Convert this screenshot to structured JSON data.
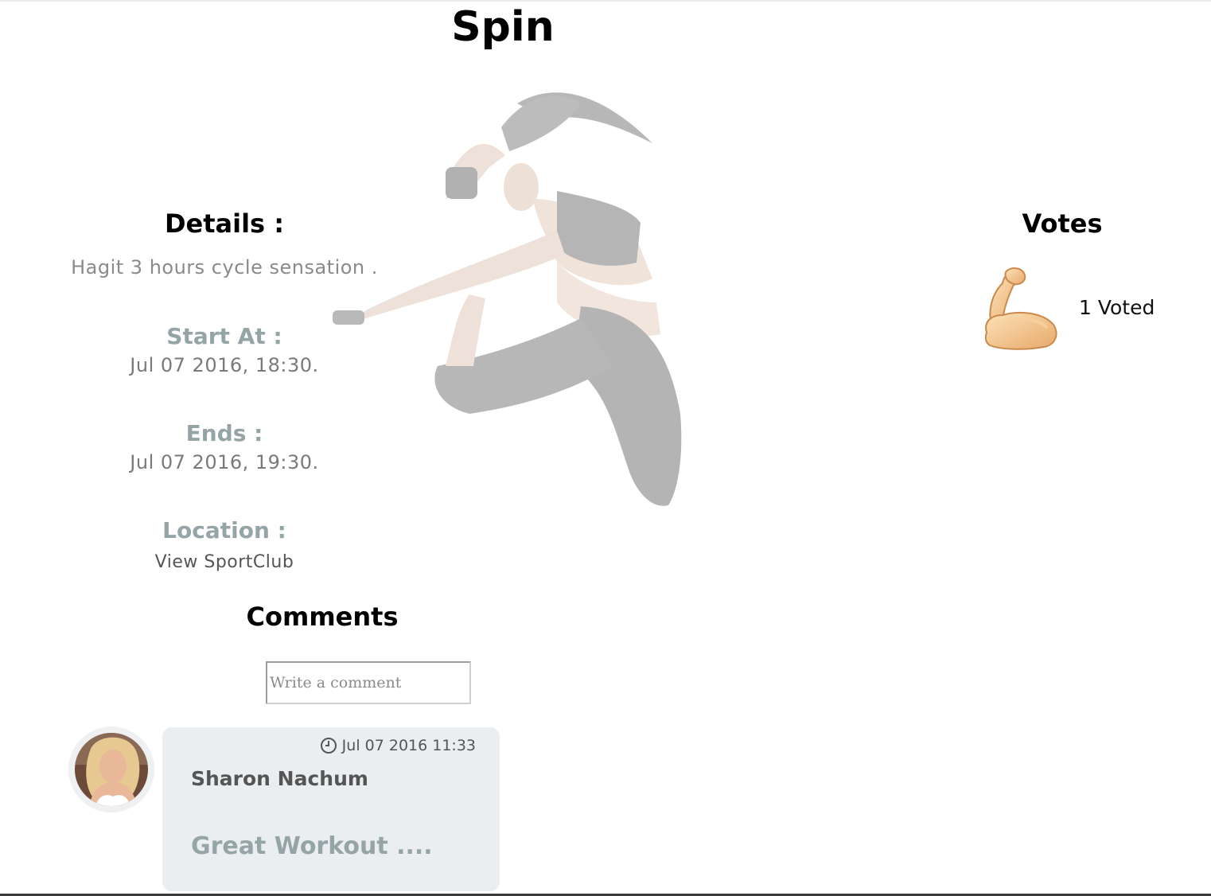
{
  "page": {
    "title": "Spin"
  },
  "details": {
    "heading": "Details :",
    "description": "Hagit 3 hours cycle sensation .",
    "start": {
      "label": "Start At :",
      "value": "Jul 07 2016, 18:30."
    },
    "end": {
      "label": "Ends :",
      "value": "Jul 07 2016, 19:30."
    },
    "location": {
      "label": "Location :",
      "link": "View SportClub"
    }
  },
  "comments": {
    "heading": "Comments",
    "input_placeholder": "Write a comment",
    "items": [
      {
        "time": "Jul 07 2016 11:33",
        "author": "Sharon Nachum",
        "text": "Great Workout ....",
        "time_icon": "clock-icon"
      }
    ]
  },
  "votes": {
    "heading": "Votes",
    "icon": "flexed-biceps-icon",
    "count_label": "1 Voted"
  },
  "colors": {
    "label": "#95a5a6",
    "muted_text": "#8a8a8a",
    "comment_bg": "#ebeef0"
  }
}
